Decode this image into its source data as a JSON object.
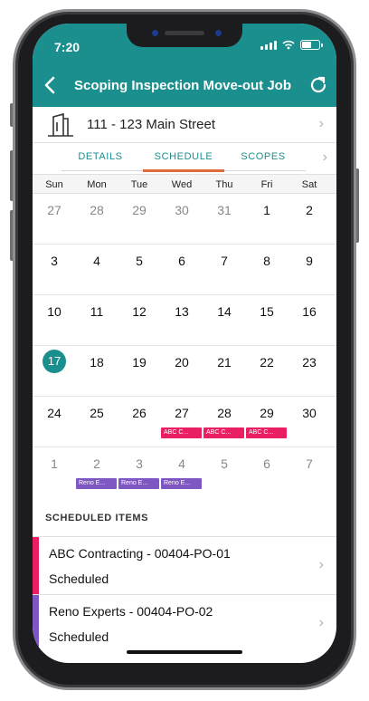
{
  "status_bar": {
    "time": "7:20"
  },
  "header": {
    "title": "Scoping Inspection Move-out Job"
  },
  "address": {
    "text": "111 - 123 Main Street"
  },
  "tabs": [
    {
      "label": "DETAILS",
      "active": false
    },
    {
      "label": "SCHEDULE",
      "active": true
    },
    {
      "label": "SCOPES",
      "active": false
    }
  ],
  "calendar": {
    "weekdays": [
      "Sun",
      "Mon",
      "Tue",
      "Wed",
      "Thu",
      "Fri",
      "Sat"
    ],
    "weeks": [
      [
        "27",
        "28",
        "29",
        "30",
        "31",
        "1",
        "2"
      ],
      [
        "3",
        "4",
        "5",
        "6",
        "7",
        "8",
        "9"
      ],
      [
        "10",
        "11",
        "12",
        "13",
        "14",
        "15",
        "16"
      ],
      [
        "17",
        "18",
        "19",
        "20",
        "21",
        "22",
        "23"
      ],
      [
        "24",
        "25",
        "26",
        "27",
        "28",
        "29",
        "30"
      ],
      [
        "1",
        "2",
        "3",
        "4",
        "5",
        "6",
        "7"
      ]
    ],
    "today": "17",
    "events": {
      "abc": "ABC C...",
      "reno": "Reno E..."
    }
  },
  "scheduled": {
    "header": "SCHEDULED ITEMS",
    "items": [
      {
        "name": "ABC Contracting - 00404-PO-01",
        "status": "Scheduled",
        "color": "#e91e63"
      },
      {
        "name": "Reno Experts - 00404-PO-02",
        "status": "Scheduled",
        "color": "#7e57c2"
      }
    ]
  },
  "colors": {
    "accent": "#1a8f8d",
    "tab_underline": "#e06a3c",
    "abc_event": "#e91e63",
    "reno_event": "#7e57c2"
  }
}
